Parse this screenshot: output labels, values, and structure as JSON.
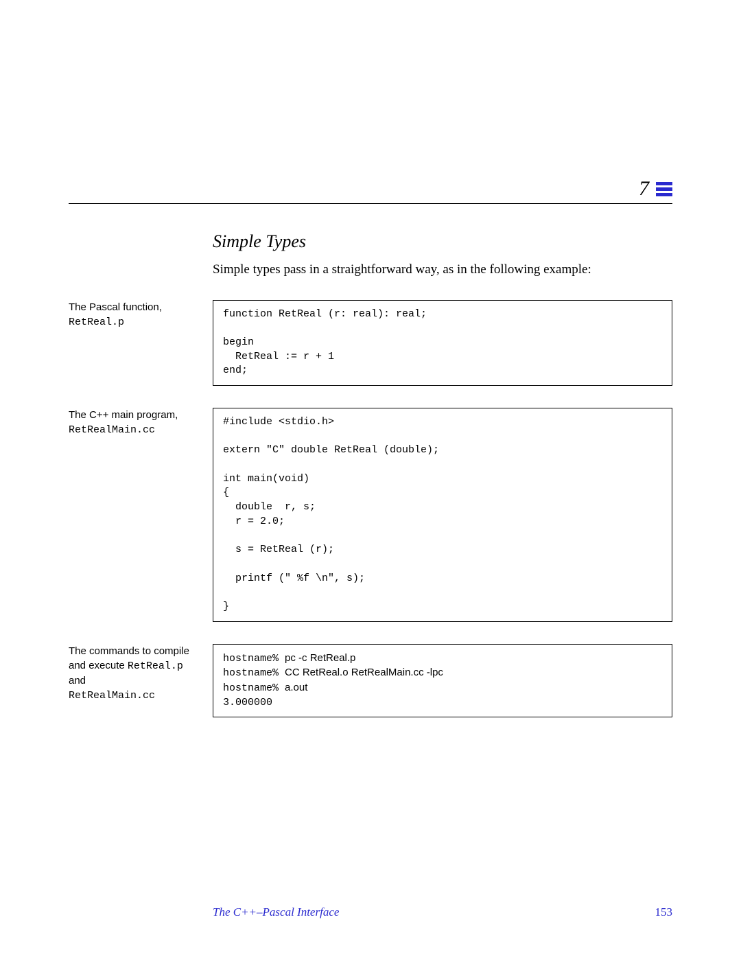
{
  "chapter_number": "7",
  "section": {
    "title": "Simple Types",
    "body": "Simple types pass in a straightforward way, as in the following example:"
  },
  "blocks": [
    {
      "caption_text": "The Pascal function,",
      "caption_mono": "RetReal.p",
      "code": "function RetReal (r: real): real;\n\nbegin\n  RetReal := r + 1\nend;"
    },
    {
      "caption_text": "The C++ main program,",
      "caption_mono": "RetRealMain.cc",
      "code": "#include <stdio.h>\n\nextern \"C\" double RetReal (double);\n\nint main(void)\n{\n  double  r, s;\n  r = 2.0;\n\n  s = RetReal (r);\n\n  printf (\" %f \\n\", s);\n\n}"
    }
  ],
  "command_block": {
    "caption_part1": "The commands to compile and execute ",
    "caption_mono1": "RetReal.p",
    "caption_part2": " and",
    "caption_mono2": "RetRealMain.cc",
    "lines": [
      {
        "prompt": "hostname% ",
        "cmd": "pc -c RetReal.p"
      },
      {
        "prompt": "hostname% ",
        "cmd": "CC RetReal.o RetRealMain.cc -lpc"
      },
      {
        "prompt": "hostname% ",
        "cmd": "a.out"
      }
    ],
    "output": "3.000000"
  },
  "footer": {
    "title": "The C++–Pascal Interface",
    "page": "153"
  }
}
